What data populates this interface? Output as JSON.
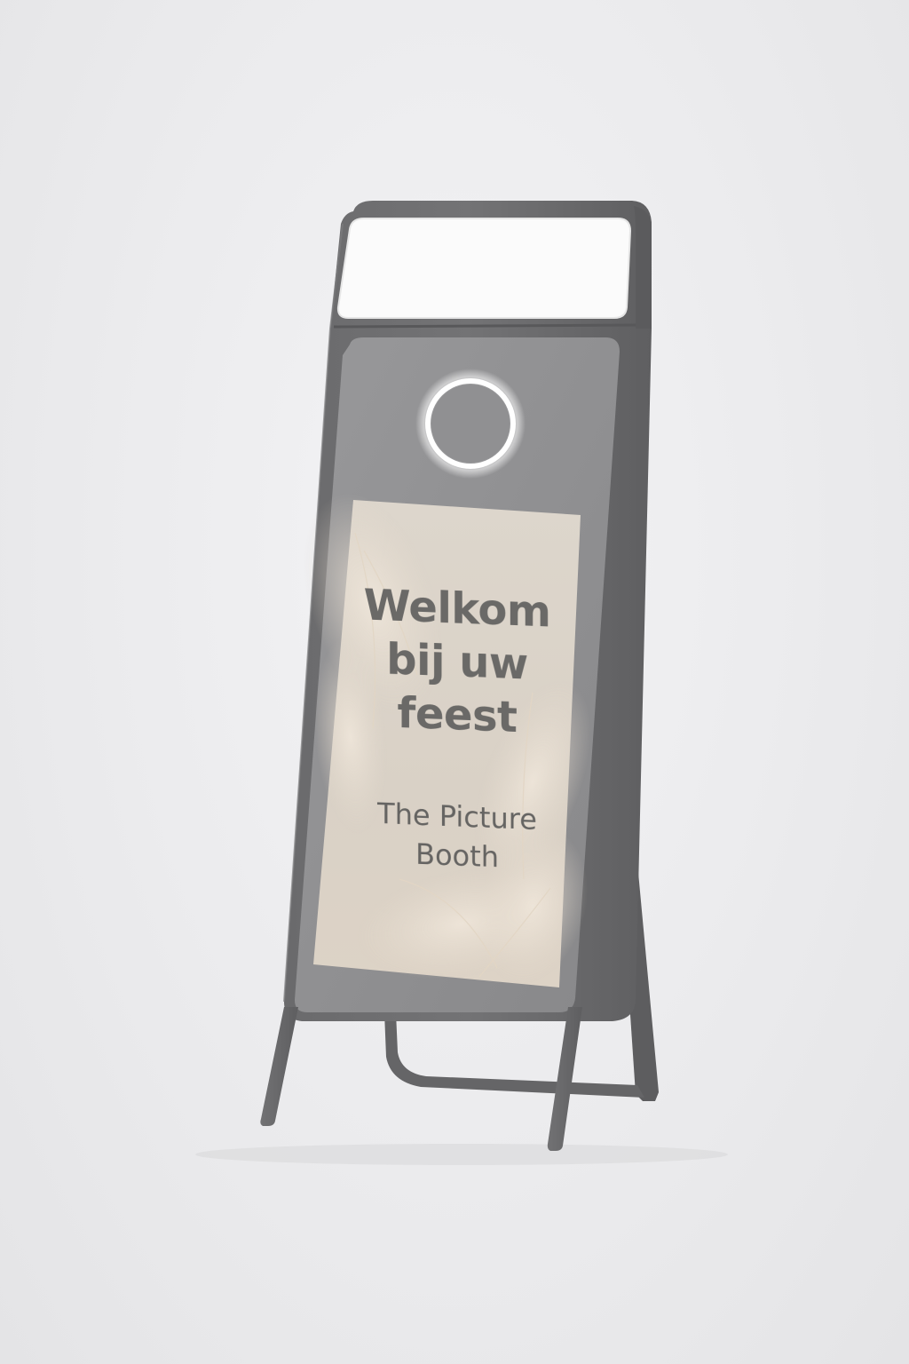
{
  "screen": {
    "headline_lines": [
      "Welkom",
      "bij uw",
      "feest"
    ],
    "brand_lines": [
      "The Picture",
      "Booth"
    ]
  },
  "colors": {
    "frame": "#6e6e70",
    "frame_dark": "#5a5a5c",
    "bezel": "#8f8f91",
    "screen_bg": "#dcd5cb",
    "light_panel": "#fbfbfb",
    "ring_light": "#ffffff",
    "text": "#6a6967"
  },
  "icons": [
    "ring-light-icon",
    "pampas-grass-decoration"
  ]
}
